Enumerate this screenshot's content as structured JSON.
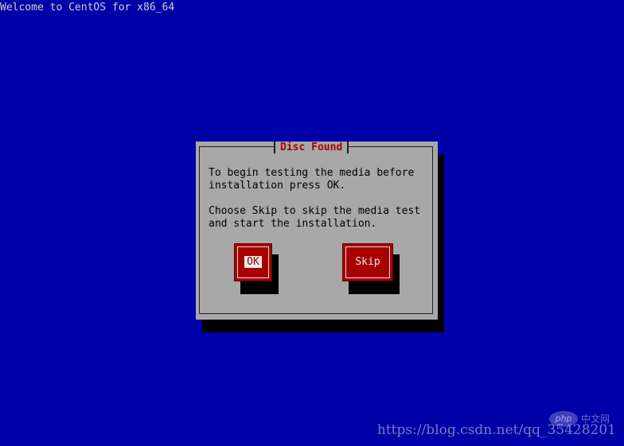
{
  "screen": {
    "header_text": "Welcome to CentOS for x86_64"
  },
  "dialog": {
    "title": "Disc Found",
    "message_line1": "To begin testing the media before\ninstallation press OK.",
    "message_line2": "Choose Skip to skip the media test\nand start the installation.",
    "ok_label": "OK",
    "skip_label": "Skip"
  },
  "watermark": {
    "logo_text": "php",
    "cn_text": "中文网",
    "url": "https://blog.csdn.net/qq_35428201"
  },
  "colors": {
    "background": "#0000a8",
    "dialog": "#a8a8a8",
    "title": "#a80000",
    "button": "#a80000",
    "shadow": "#000000"
  }
}
